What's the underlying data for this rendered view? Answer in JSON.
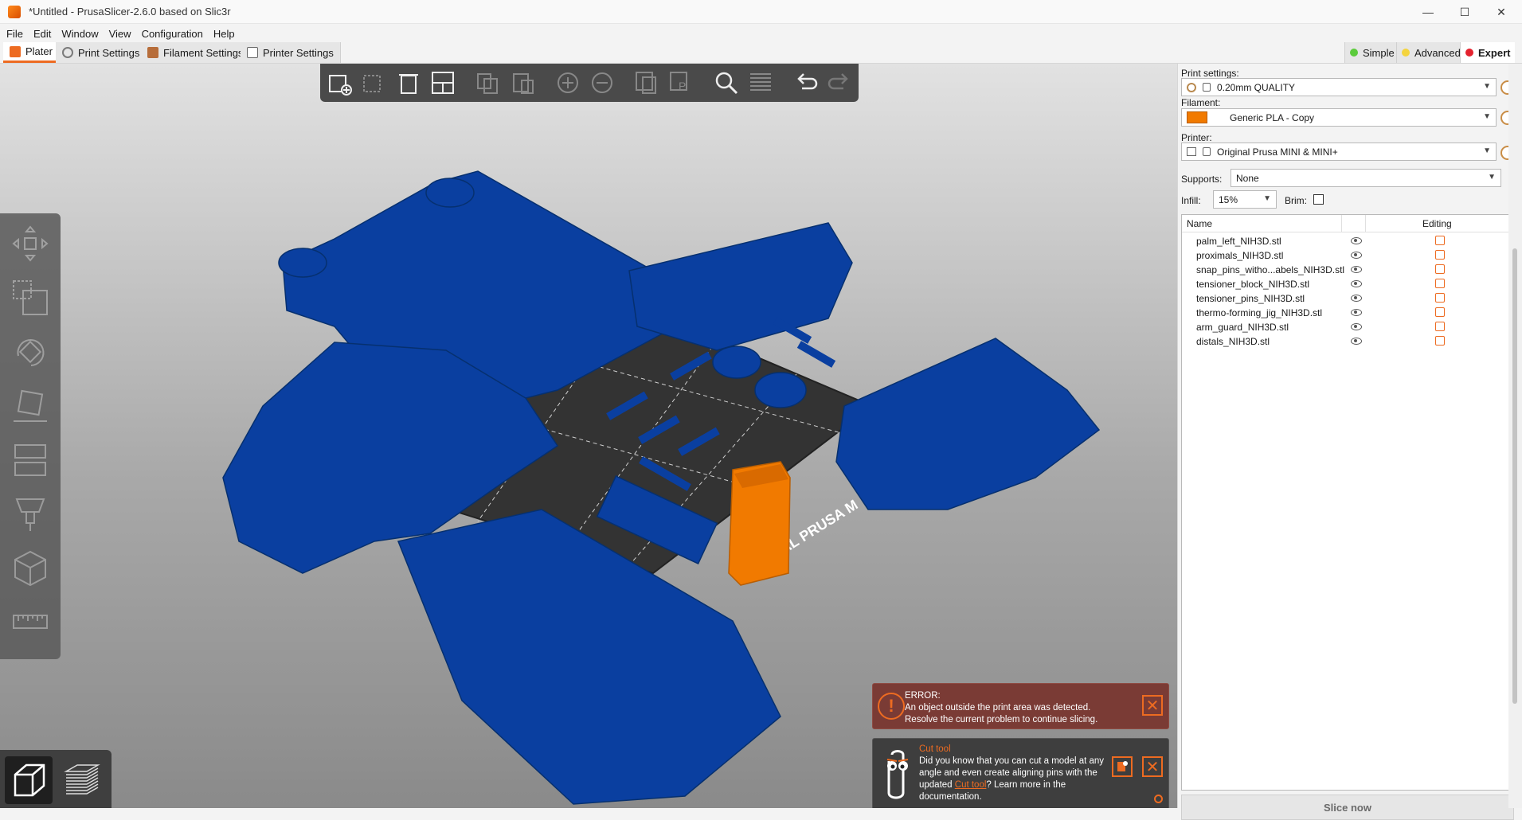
{
  "window": {
    "title": "*Untitled - PrusaSlicer-2.6.0 based on Slic3r",
    "minimize": "—",
    "maximize": "☐",
    "close": "✕"
  },
  "menu": [
    "File",
    "Edit",
    "Window",
    "View",
    "Configuration",
    "Help"
  ],
  "tabs": {
    "plater": "Plater",
    "print_settings": "Print Settings",
    "filament_settings": "Filament Settings",
    "printer_settings": "Printer Settings"
  },
  "modes": {
    "simple": "Simple",
    "advanced": "Advanced",
    "expert": "Expert",
    "colors": {
      "simple": "#5ccb3c",
      "advanced": "#f4d43e",
      "expert": "#e4222e"
    }
  },
  "sidebar": {
    "print_settings_label": "Print settings:",
    "print_settings_value": "0.20mm QUALITY",
    "filament_label": "Filament:",
    "filament_value": "Generic PLA - Copy",
    "filament_color": "#f17a00",
    "printer_label": "Printer:",
    "printer_value": "Original Prusa MINI & MINI+",
    "supports_label": "Supports:",
    "supports_value": "None",
    "infill_label": "Infill:",
    "infill_value": "15%",
    "brim_label": "Brim:",
    "brim_checked": false,
    "columns": {
      "name": "Name",
      "editing": "Editing"
    },
    "objects": [
      "palm_left_NIH3D.stl",
      "proximals_NIH3D.stl",
      "snap_pins_witho...abels_NIH3D.stl",
      "tensioner_block_NIH3D.stl",
      "tensioner_pins_NIH3D.stl",
      "thermo-forming_jig_NIH3D.stl",
      "arm_guard_NIH3D.stl",
      "distals_NIH3D.stl"
    ],
    "slice_button": "Slice now"
  },
  "viewport": {
    "bed_label": "ORIGINAL PRUSA M",
    "model_color": "#0a3fa0",
    "selected_color": "#f17a00",
    "accent": "#ed6b21"
  },
  "notifications": {
    "error_title": "ERROR:",
    "error_line1": "An object outside the print area was detected.",
    "error_line2": "Resolve the current problem to continue slicing.",
    "hint_title": "Cut tool",
    "hint_text_1": "Did you know that you can cut a model at any angle and even create aligning pins with the updated ",
    "hint_link": "Cut tool",
    "hint_text_2": "? Learn more in the documentation."
  }
}
